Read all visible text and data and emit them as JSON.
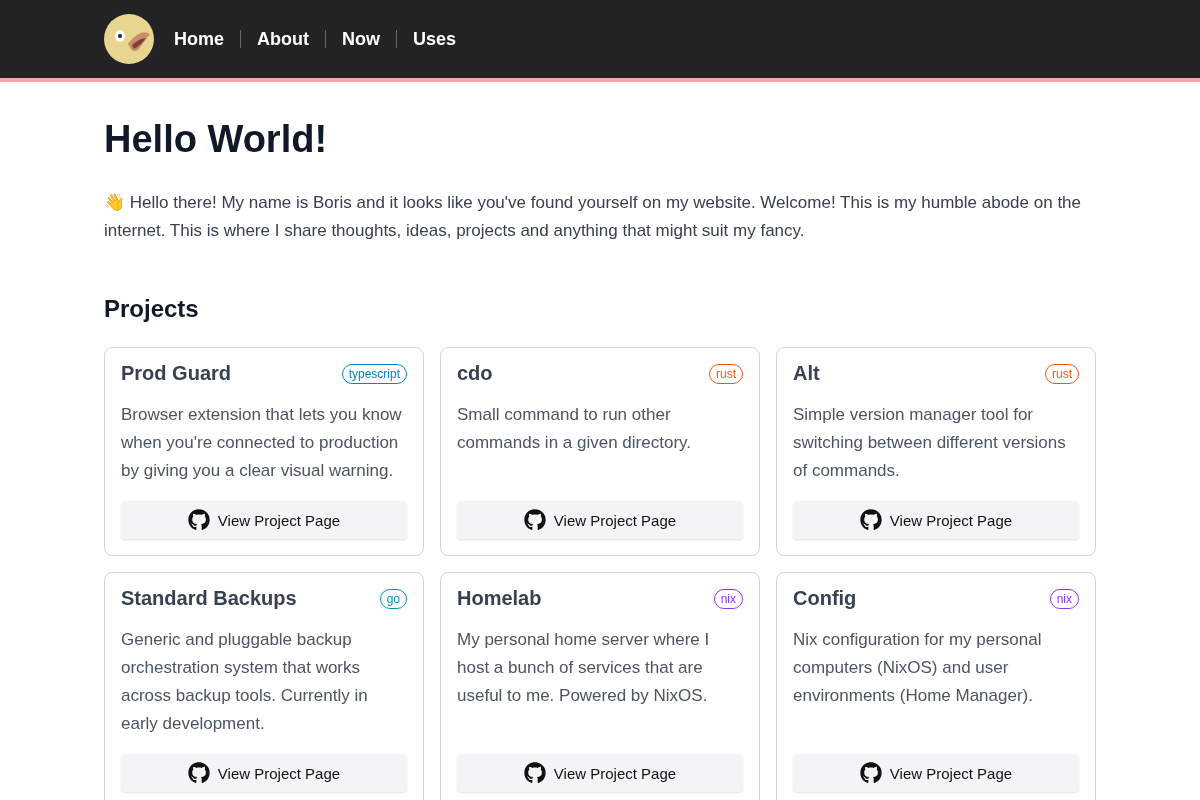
{
  "nav": {
    "links": [
      "Home",
      "About",
      "Now",
      "Uses"
    ]
  },
  "heading": "Hello World!",
  "intro": "👋 Hello there! My name is Boris and it looks like you've found yourself on my website. Welcome! This is my humble abode on the internet. This is where I share thoughts, ideas, projects and anything that might suit my fancy.",
  "projects": {
    "title": "Projects",
    "items": [
      {
        "name": "Prod Guard",
        "tag": "typescript",
        "color": "#0284c7",
        "description": "Browser extension that lets you know when you're connected to production by giving you a clear visual warning.",
        "button": "View Project Page"
      },
      {
        "name": "cdo",
        "tag": "rust",
        "color": "#ea580c",
        "description": "Small command to run other commands in a given directory.",
        "button": "View Project Page"
      },
      {
        "name": "Alt",
        "tag": "rust",
        "color": "#ea580c",
        "description": "Simple version manager tool for switching between different versions of commands.",
        "button": "View Project Page"
      },
      {
        "name": "Standard Backups",
        "tag": "go",
        "color": "#0891b2",
        "description": "Generic and pluggable backup orchestration system that works across backup tools. Currently in early development.",
        "button": "View Project Page"
      },
      {
        "name": "Homelab",
        "tag": "nix",
        "color": "#9333ea",
        "description": "My personal home server where I host a bunch of services that are useful to me. Powered by NixOS.",
        "button": "View Project Page"
      },
      {
        "name": "Config",
        "tag": "nix",
        "color": "#9333ea",
        "description": "Nix configuration for my personal computers (NixOS) and user environments (Home Manager).",
        "button": "View Project Page"
      }
    ]
  }
}
